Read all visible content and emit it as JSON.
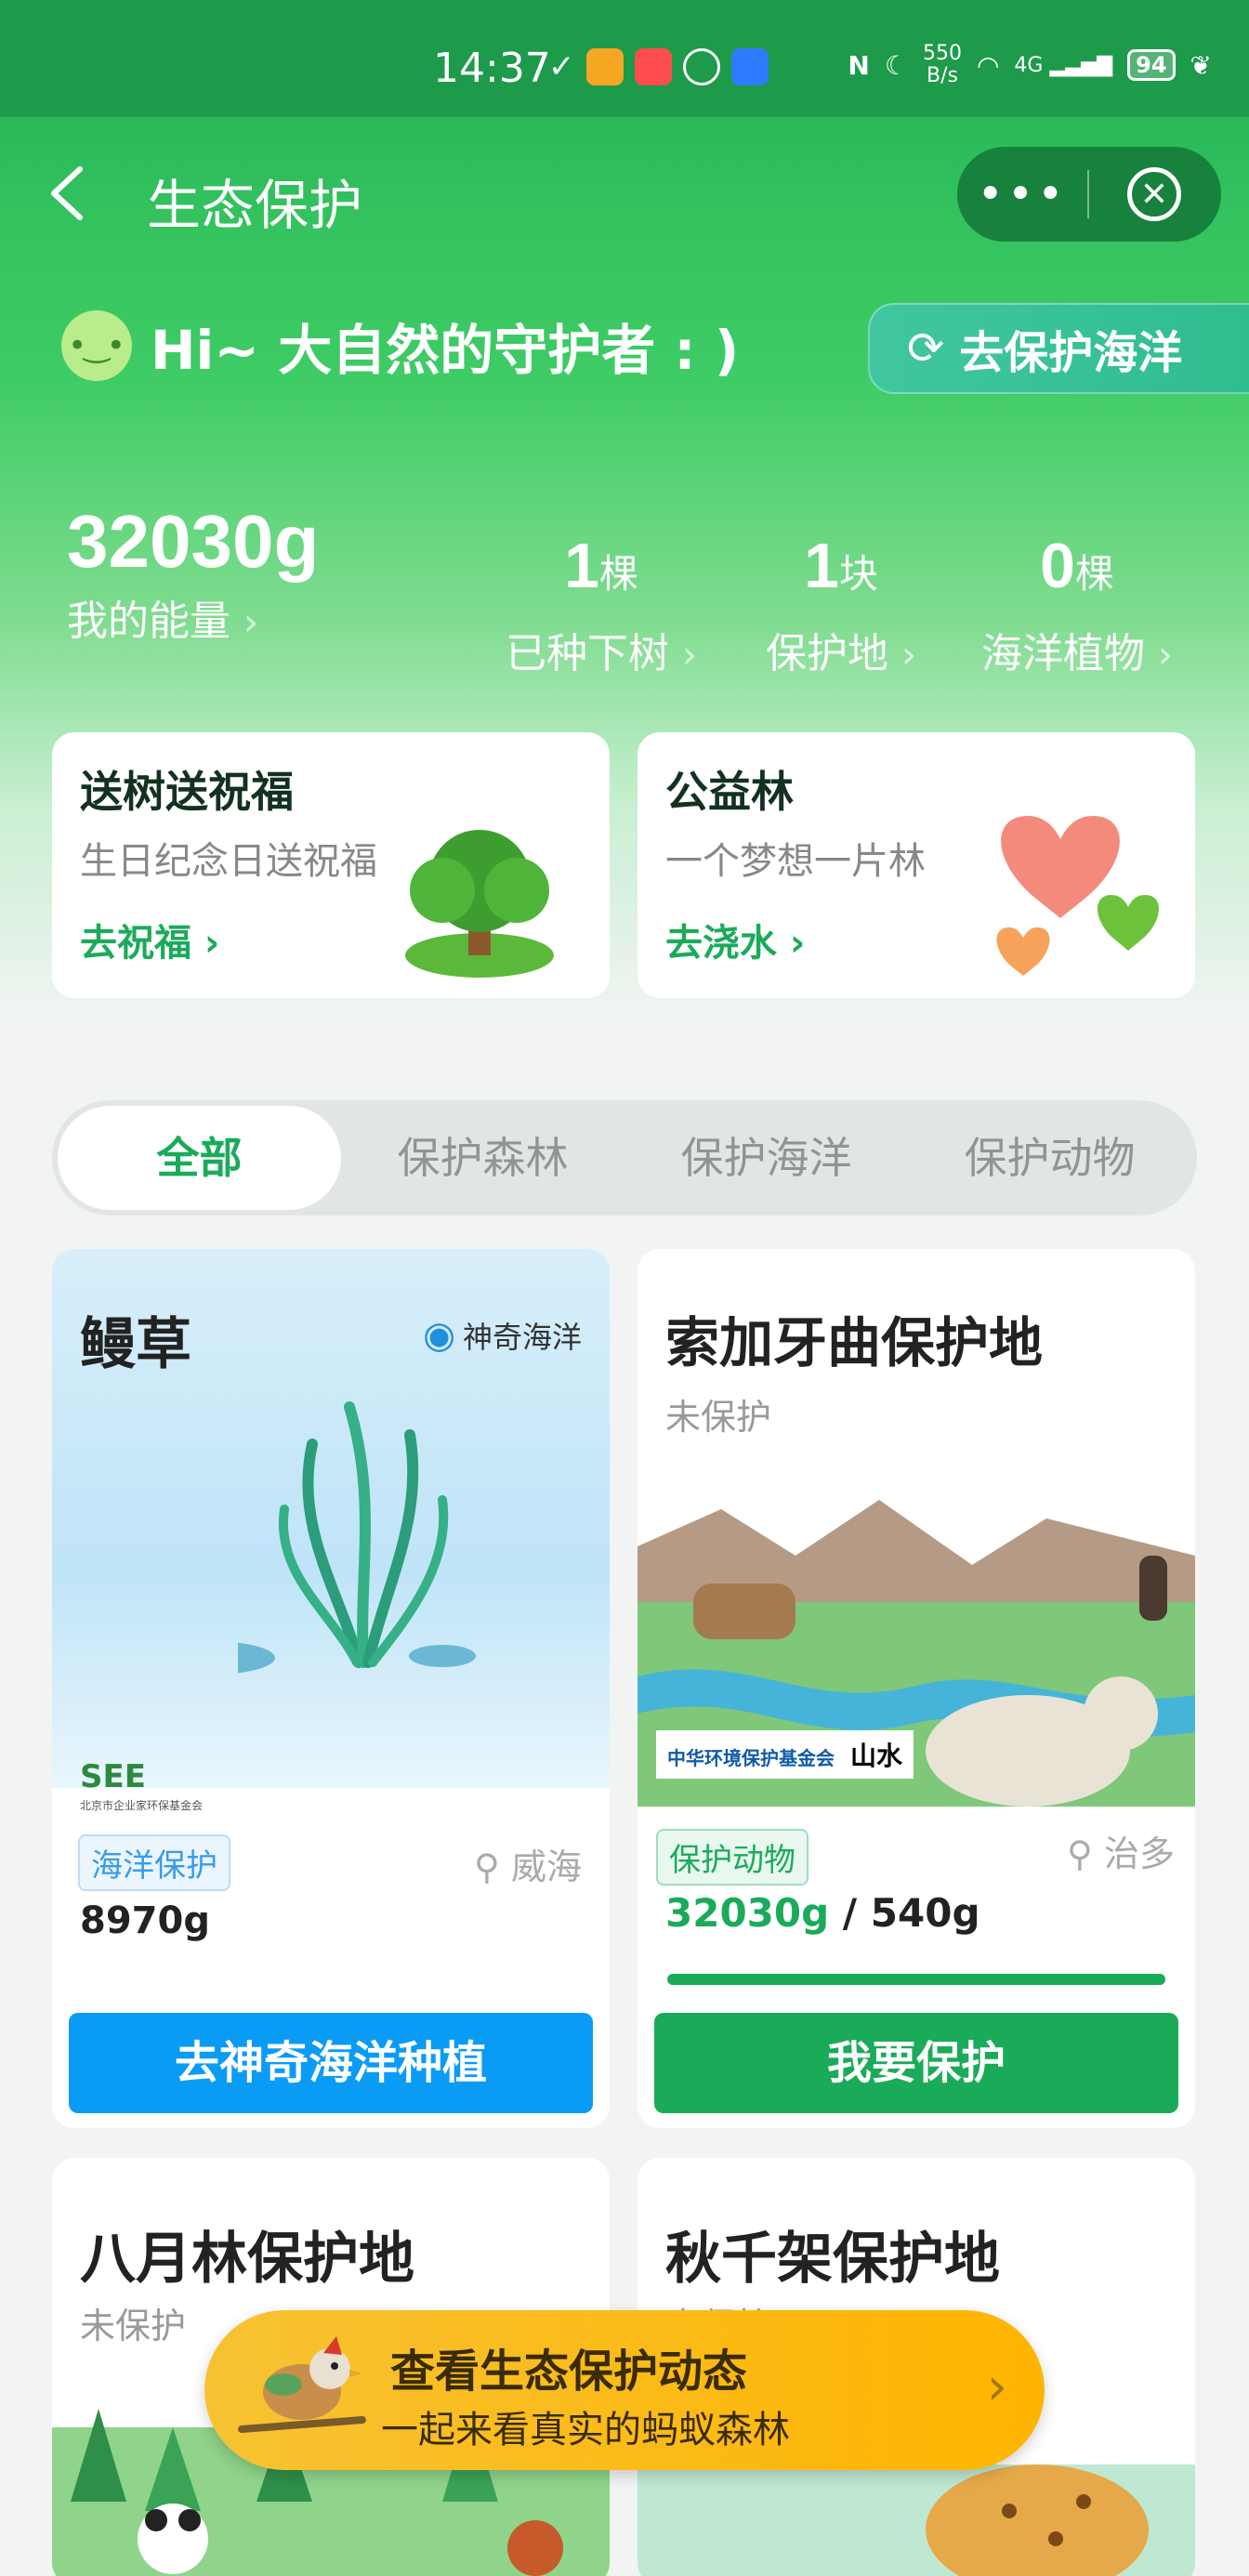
{
  "status_bar": {
    "time": "14:37",
    "net_speed": "550",
    "net_unit": "B/s",
    "signal": "4G",
    "battery": "94"
  },
  "nav": {
    "back_icon": "chevron-left-icon",
    "title": "生态保护",
    "more_icon": "more-dots-icon",
    "close_icon": "close-circle-icon"
  },
  "greeting": {
    "text": "Hi~ 大自然的守护者 : )",
    "ocean_button": "去保护海洋"
  },
  "stats": [
    {
      "value": "32030g",
      "unit": "",
      "label": "我的能量"
    },
    {
      "value": "1",
      "unit": "棵",
      "label": "已种下树"
    },
    {
      "value": "1",
      "unit": "块",
      "label": "保护地"
    },
    {
      "value": "0",
      "unit": "棵",
      "label": "海洋植物"
    }
  ],
  "promos": [
    {
      "title": "送树送祝福",
      "subtitle": "生日纪念日送祝福",
      "link": "去祝福 ›"
    },
    {
      "title": "公益林",
      "subtitle": "一个梦想一片林",
      "link": "去浇水 ›"
    }
  ],
  "tabs": [
    "全部",
    "保护森林",
    "保护海洋",
    "保护动物"
  ],
  "cards": [
    {
      "title": "鳗草",
      "brand": "神奇海洋",
      "sponsor": "SEE",
      "sponsor_sub": "北京市企业家环保基金会",
      "tag": "海洋保护",
      "location": "威海",
      "energy": "8970g",
      "button": "去神奇海洋种植"
    },
    {
      "title": "索加牙曲保护地",
      "status": "未保护",
      "org": "中华环境保护基金会",
      "org_logo": "山水",
      "tag": "保护动物",
      "location": "治多",
      "progress_current": "32030g",
      "progress_sep": " / ",
      "progress_target": "540g",
      "progress_fraction": 1.0,
      "button": "我要保护"
    },
    {
      "title": "八月林保护地",
      "status": "未保护"
    },
    {
      "title": "秋千架保护地",
      "status": "未保护"
    }
  ],
  "banner": {
    "title": "查看生态保护动态",
    "subtitle": "一起来看真实的蚂蚁森林"
  },
  "colors": {
    "brand_green": "#1aab5a",
    "ocean_blue": "#0a9cf5",
    "banner_yellow": "#f7c233"
  }
}
